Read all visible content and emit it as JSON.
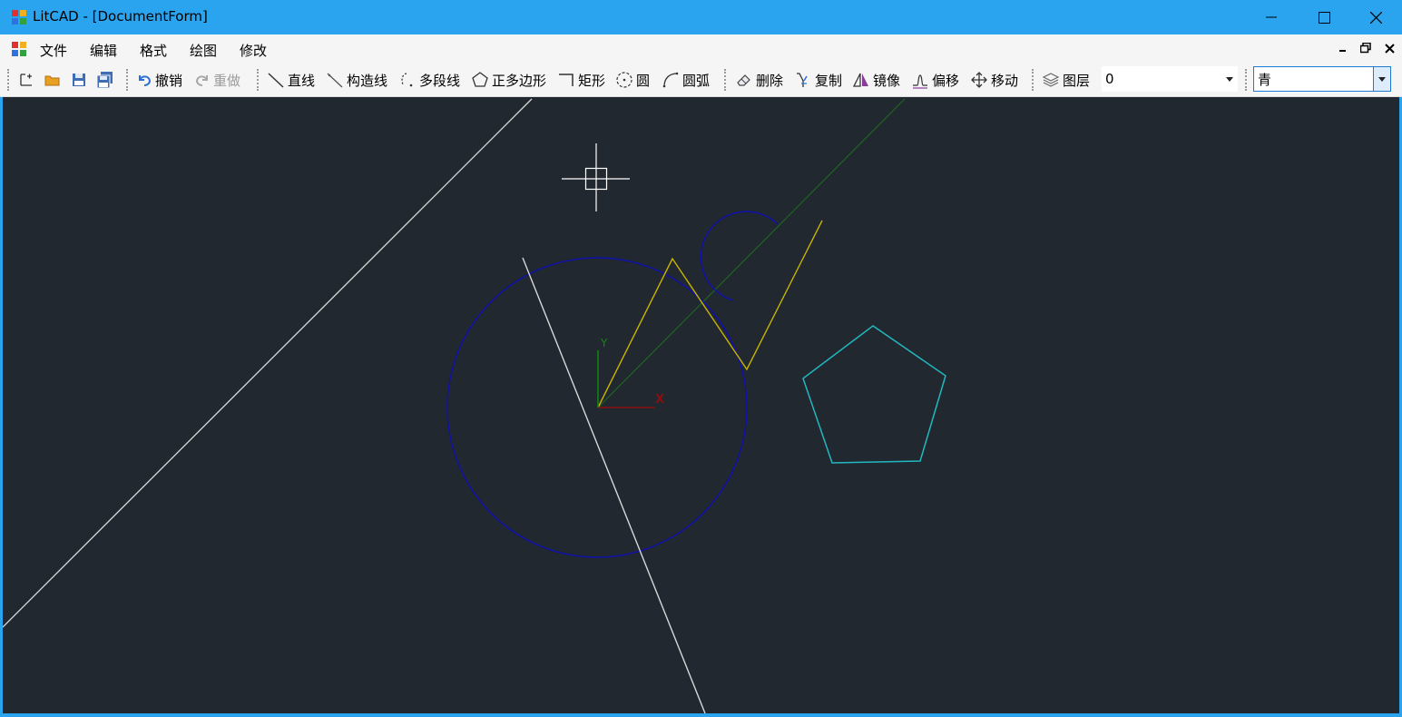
{
  "window": {
    "title": "LitCAD - [DocumentForm]",
    "controls": [
      "minimize-icon",
      "maximize-icon",
      "close-icon"
    ]
  },
  "menu": {
    "items": [
      {
        "label": "文件"
      },
      {
        "label": "编辑"
      },
      {
        "label": "格式"
      },
      {
        "label": "绘图"
      },
      {
        "label": "修改"
      }
    ],
    "mdi_controls": [
      "mdi-minimize-icon",
      "mdi-restore-icon",
      "mdi-close-icon"
    ]
  },
  "toolbar": {
    "file_icons": [
      "new-icon",
      "open-folder-icon",
      "save-icon",
      "save-all-icon"
    ],
    "undo": {
      "label": "撤销",
      "icon": "undo-icon"
    },
    "redo": {
      "label": "重做",
      "icon": "redo-icon",
      "enabled": false
    },
    "draw": [
      {
        "label": "直线",
        "icon": "line-icon"
      },
      {
        "label": "构造线",
        "icon": "construction-line-icon"
      },
      {
        "label": "多段线",
        "icon": "polyline-icon"
      },
      {
        "label": "正多边形",
        "icon": "polygon-icon"
      },
      {
        "label": "矩形",
        "icon": "rectangle-icon"
      },
      {
        "label": "圆",
        "icon": "circle-icon"
      },
      {
        "label": "圆弧",
        "icon": "arc-icon"
      }
    ],
    "modify": [
      {
        "label": "删除",
        "icon": "eraser-icon"
      },
      {
        "label": "复制",
        "icon": "copy-icon"
      },
      {
        "label": "镜像",
        "icon": "mirror-icon"
      },
      {
        "label": "偏移",
        "icon": "offset-icon"
      },
      {
        "label": "移动",
        "icon": "move-icon"
      }
    ],
    "layer": {
      "label": "图层",
      "icon": "layers-icon",
      "value": "0"
    },
    "color": {
      "value": "青"
    }
  },
  "canvas": {
    "background": "#212830",
    "axis_labels": {
      "x": "X",
      "y": "Y"
    },
    "colors": {
      "circle": "#1111aa",
      "arc": "#1111aa",
      "polyline": "#c8b400",
      "polygon": "#22b8c0",
      "white_line": "#d8d8d8",
      "construction_line": "#1e6a1e",
      "x_axis": "#8b1010",
      "y_axis": "#118811",
      "cursor": "#ffffff"
    }
  }
}
